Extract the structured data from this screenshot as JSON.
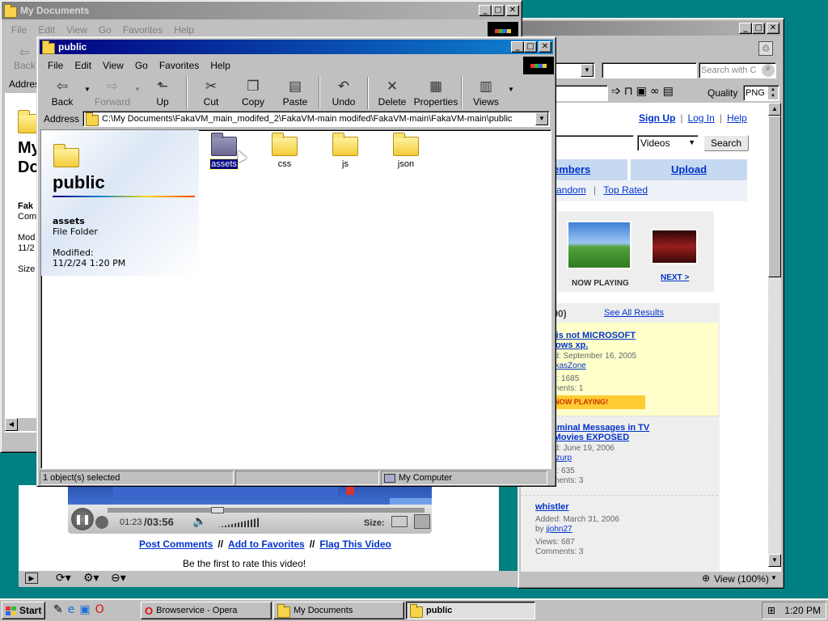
{
  "my_documents_window": {
    "title": "My Documents",
    "menu": [
      "File",
      "Edit",
      "View",
      "Go",
      "Favorites",
      "Help"
    ],
    "back_label": "Back",
    "address_label": "Addres",
    "side_partial": {
      "big": [
        "My",
        "Do"
      ],
      "name": "Fak",
      "sub": "Com",
      "modified": "Mod",
      "date": "11/2",
      "size": "Size"
    }
  },
  "browser_window": {
    "search_placeholder": "Search with C",
    "quality_label": "Quality",
    "quality_value": "PNG",
    "top_links": [
      "Sign Up",
      "Log In",
      "Help"
    ],
    "search_select": "Videos",
    "search_button": "Search",
    "tabs": [
      "embers",
      "Upload"
    ],
    "subtabs": [
      "andom",
      "Top Rated"
    ],
    "now_playing": "NOW PLAYING",
    "next": "NEXT >",
    "results_count": "(4 of 290)",
    "see_all": "See All Results",
    "results": [
      {
        "title": "This is not MICROSOFT windows xp.",
        "added": "Added: September 16, 2005",
        "by": "by",
        "user": "LukasZone",
        "views": "Views: 1685",
        "comments": "Comments: 1",
        "badge": "<<< NOW PLAYING!"
      },
      {
        "title": "Subliminal Messages in TV and Movies EXPOSED",
        "added": "Added: June 19, 2006",
        "by": "by",
        "user": "sizzurp",
        "views": "Views: 635",
        "comments": "Comments: 3"
      },
      {
        "title": "whistler",
        "added": "Added: March 31, 2006",
        "by": "by",
        "user": "jjohn27",
        "views": "Views: 687",
        "comments": "Comments: 3"
      }
    ],
    "player": {
      "time_current": "01:23",
      "time_total": "/03:56",
      "size_label": "Size:"
    },
    "actions": [
      "Post Comments",
      "Add to Favorites",
      "Flag This Video"
    ],
    "separator": "//",
    "rate_text": "Be the first to rate this video!",
    "zoom": "View (100%)",
    "pipe": "|"
  },
  "public_window": {
    "title": "public",
    "menu": [
      "File",
      "Edit",
      "View",
      "Go",
      "Favorites",
      "Help"
    ],
    "toolbar": [
      {
        "label": "Back",
        "icon": "arrow-left-icon",
        "glyph": "⇦"
      },
      {
        "label": "Forward",
        "icon": "arrow-right-icon",
        "glyph": "⇨"
      },
      {
        "label": "Up",
        "icon": "folder-up-icon",
        "glyph": "⬑"
      },
      {
        "label": "Cut",
        "icon": "scissors-icon",
        "glyph": "✂"
      },
      {
        "label": "Copy",
        "icon": "copy-icon",
        "glyph": "❐"
      },
      {
        "label": "Paste",
        "icon": "paste-icon",
        "glyph": "▤"
      },
      {
        "label": "Undo",
        "icon": "undo-icon",
        "glyph": "↶"
      },
      {
        "label": "Delete",
        "icon": "delete-icon",
        "glyph": "✕"
      },
      {
        "label": "Properties",
        "icon": "properties-icon",
        "glyph": "▦"
      },
      {
        "label": "Views",
        "icon": "views-icon",
        "glyph": "▥"
      }
    ],
    "address_label": "Address",
    "address_value": "C:\\My Documents\\FakaVM_main_modifed_2\\FakaVM-main modifed\\FakaVM-main\\FakaVM-main\\public",
    "side_title": "public",
    "selected_name": "assets",
    "selected_type": "File Folder",
    "modified_label": "Modified:",
    "modified_value": "11/2/24 1:20 PM",
    "items": [
      "assets",
      "css",
      "js",
      "json"
    ],
    "status_left": "1 object(s) selected",
    "status_right": "My Computer"
  },
  "taskbar": {
    "start": "Start",
    "tasks": [
      "Browservice - Opera",
      "My Documents",
      "public"
    ],
    "clock": "1:20 PM"
  },
  "colors": {
    "desktop": "#008080",
    "active_title": "#000080",
    "link": "#0033cc",
    "tab_bg": "#c5d9f1"
  }
}
